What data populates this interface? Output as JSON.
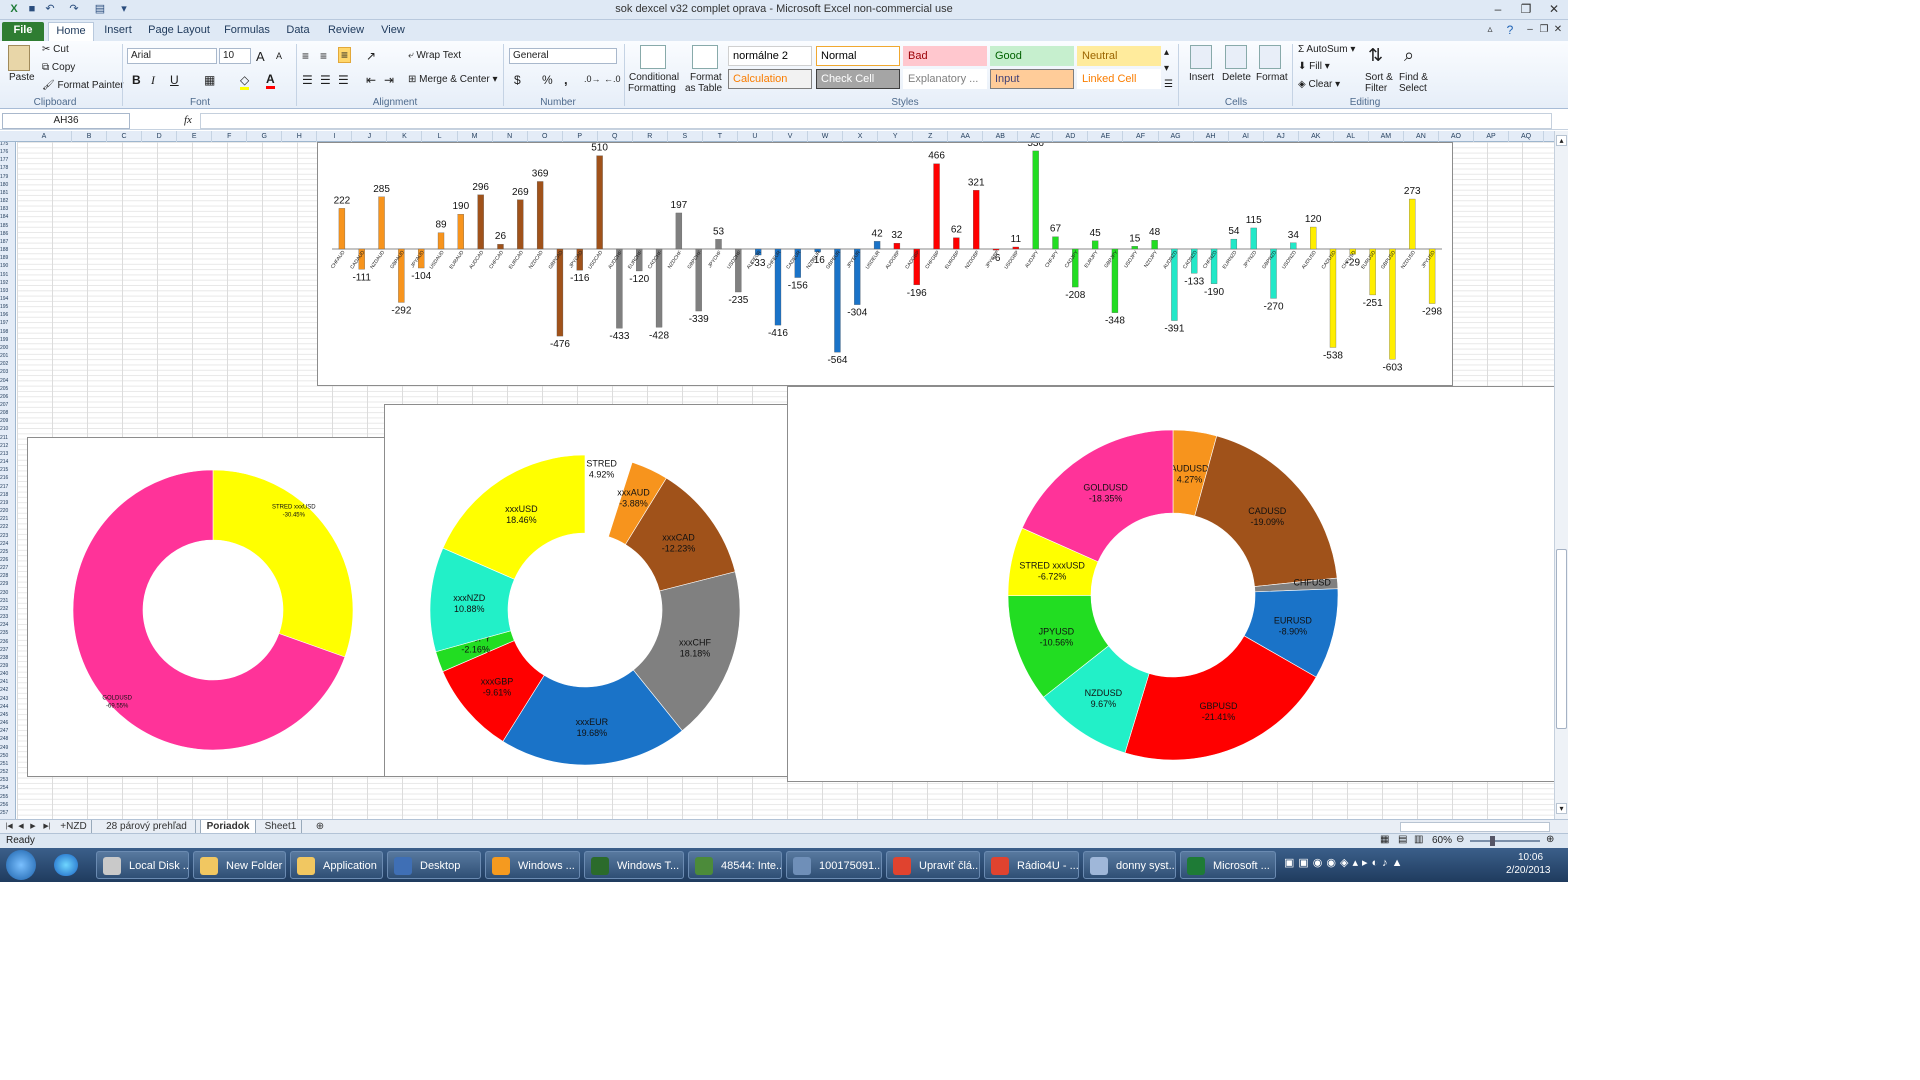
{
  "window": {
    "title": "sok dexcel v32 complet oprava  -  Microsoft Excel non-commercial use"
  },
  "qat": {
    "undo": "↶",
    "redo": "↷",
    "more": "▾"
  },
  "tabs": [
    "File",
    "Home",
    "Insert",
    "Page Layout",
    "Formulas",
    "Data",
    "Review",
    "View"
  ],
  "ribbon": {
    "clipboard": {
      "label": "Clipboard",
      "paste": "Paste",
      "cut": "Cut",
      "copy": "Copy",
      "format_painter": "Format Painter"
    },
    "font": {
      "label": "Font",
      "name": "Arial",
      "size": "10",
      "bold": "B",
      "italic": "I",
      "underline": "U",
      "grow": "A",
      "shrink": "A"
    },
    "alignment": {
      "label": "Alignment",
      "wrap": "Wrap Text",
      "merge": "Merge & Center"
    },
    "number": {
      "label": "Number",
      "format": "General",
      "currency": "$",
      "percent": "%",
      "comma": ","
    },
    "styles": {
      "label": "Styles",
      "cond": "Conditional",
      "cond2": "Formatting",
      "fmt_table": "Format",
      "fmt_table2": "as Table",
      "items": [
        {
          "name": "normálne 2",
          "bg": "#ffffff",
          "color": "#000000",
          "border": "#d0d0d0"
        },
        {
          "name": "Normal",
          "bg": "#ffffff",
          "color": "#000000",
          "border": "#f0a830"
        },
        {
          "name": "Bad",
          "bg": "#ffc7ce",
          "color": "#9c0006",
          "border": "#ffc7ce"
        },
        {
          "name": "Good",
          "bg": "#c6efce",
          "color": "#006100",
          "border": "#c6efce"
        },
        {
          "name": "Neutral",
          "bg": "#ffeb9c",
          "color": "#9c6500",
          "border": "#ffeb9c"
        },
        {
          "name": "Calculation",
          "bg": "#f2f2f2",
          "color": "#fa7d00",
          "border": "#7f7f7f"
        },
        {
          "name": "Check Cell",
          "bg": "#a5a5a5",
          "color": "#ffffff",
          "border": "#3f3f3f"
        },
        {
          "name": "Explanatory ...",
          "bg": "#ffffff",
          "color": "#7f7f7f",
          "border": "#ffffff"
        },
        {
          "name": "Input",
          "bg": "#ffcc99",
          "color": "#3f3f76",
          "border": "#7f7f7f"
        },
        {
          "name": "Linked Cell",
          "bg": "#ffffff",
          "color": "#fa7d00",
          "border": "#ffffff"
        }
      ]
    },
    "cells": {
      "label": "Cells",
      "insert": "Insert",
      "delete": "Delete",
      "format": "Format"
    },
    "editing": {
      "label": "Editing",
      "autosum": "AutoSum",
      "fill": "Fill",
      "clear": "Clear",
      "sort": "Sort &",
      "sort2": "Filter",
      "find": "Find &",
      "find2": "Select"
    }
  },
  "formula": {
    "namebox": "AH36",
    "fx": "fx",
    "value": ""
  },
  "columns": [
    "A",
    "B",
    "C",
    "D",
    "E",
    "F",
    "G",
    "H",
    "I",
    "J",
    "K",
    "L",
    "M",
    "N",
    "O",
    "P",
    "Q",
    "R",
    "S",
    "T",
    "U",
    "V",
    "W",
    "X",
    "Y",
    "Z",
    "AA",
    "AB",
    "AC",
    "AD",
    "AE",
    "AF",
    "AG",
    "AH",
    "AI",
    "AJ",
    "AK",
    "AL",
    "AM",
    "AN",
    "AO",
    "AP",
    "AQ",
    "AR",
    "AS",
    "AT"
  ],
  "rows_start": 175,
  "rows_end": 257,
  "sheets": {
    "nav": [
      "|◀",
      "◀",
      "▶",
      "▶|"
    ],
    "tabs": [
      "+NZD",
      "28 párový prehľad",
      "Poriadok",
      "Sheet1"
    ],
    "active": "Poriadok"
  },
  "status": {
    "ready": "Ready",
    "zoom": "60%"
  },
  "taskbar": {
    "items": [
      {
        "label": "Local Disk ...",
        "color": "#c9c9c9"
      },
      {
        "label": "New Folder",
        "color": "#f1c761"
      },
      {
        "label": "Application",
        "color": "#f1c761"
      },
      {
        "label": "Desktop",
        "color": "#3f6fb5"
      },
      {
        "label": "Windows ...",
        "color": "#f59a1f"
      },
      {
        "label": "Windows T...",
        "color": "#2b6b2b"
      },
      {
        "label": "48544: Inte...",
        "color": "#4c8b3a"
      },
      {
        "label": "100175091...",
        "color": "#6f8fb8"
      },
      {
        "label": "Upraviť člá...",
        "color": "#e0432f"
      },
      {
        "label": "Rádio4U - ...",
        "color": "#e0432f"
      },
      {
        "label": "donny syst...",
        "color": "#9fb7d9"
      },
      {
        "label": "Microsoft ...",
        "color": "#1e7b36"
      }
    ],
    "time": "10:06",
    "date": "2/20/2013"
  },
  "chart_data": [
    {
      "type": "bar",
      "categories": [
        "CHFAUD",
        "CADAUD",
        "NZDAUD",
        "GBPAUD",
        "JPYAUD",
        "USDAUD",
        "EURAUD",
        "AUDCAD",
        "CHFCAD",
        "EURCAD",
        "NZDCAD",
        "GBPCAD",
        "JPYCAD",
        "USDCAD",
        "AUDCHF",
        "EURCHF",
        "CADCHF",
        "NZDCHF",
        "GBPCHF",
        "JPYCHF",
        "USDCHF",
        "AUDEUR",
        "CHFEUR",
        "CADEUR",
        "NZDEUR",
        "GBPEUR",
        "JPYEUR",
        "USDEUR",
        "AUDGBP",
        "CADGBP",
        "CHFGBP",
        "EURGBP",
        "NZDGBP",
        "JPYGBP",
        "USDGBP",
        "AUDJPY",
        "CHFJPY",
        "CADJPY",
        "EURJPY",
        "GBPJPY",
        "USDJPY",
        "NZDJPY",
        "AUDNZD",
        "CADNZD",
        "CHFNZD",
        "EURNZD",
        "JPYNZD",
        "GBPNZD",
        "USDNZD",
        "AUDUSD",
        "CADUSD",
        "CHFUSD",
        "EURUSD",
        "GBPUSD",
        "NZDUSD",
        "JPYUSD"
      ],
      "values": [
        222,
        -111,
        285,
        -292,
        -104,
        89,
        190,
        296,
        26,
        269,
        369,
        -476,
        -116,
        510,
        -433,
        -120,
        -428,
        197,
        -339,
        53,
        -235,
        -33,
        -416,
        -156,
        -16,
        -564,
        -304,
        42,
        32,
        -196,
        466,
        62,
        321,
        -6,
        11,
        536,
        67,
        -208,
        45,
        -348,
        15,
        48,
        -391,
        -133,
        -190,
        54,
        115,
        -270,
        34,
        120,
        -538,
        -29,
        -251,
        -603,
        273,
        -298
      ],
      "colors": [
        "#f7941d",
        "#f7941d",
        "#f7941d",
        "#f7941d",
        "#f7941d",
        "#f7941d",
        "#f7941d",
        "#a0521a",
        "#a0521a",
        "#a0521a",
        "#a0521a",
        "#a0521a",
        "#a0521a",
        "#a0521a",
        "#808080",
        "#808080",
        "#808080",
        "#808080",
        "#808080",
        "#808080",
        "#808080",
        "#1a73c8",
        "#1a73c8",
        "#1a73c8",
        "#1a73c8",
        "#1a73c8",
        "#1a73c8",
        "#1a73c8",
        "#ff0000",
        "#ff0000",
        "#ff0000",
        "#ff0000",
        "#ff0000",
        "#ff0000",
        "#ff0000",
        "#22dd22",
        "#22dd22",
        "#22dd22",
        "#22dd22",
        "#22dd22",
        "#22dd22",
        "#22dd22",
        "#22e8c8",
        "#22e8c8",
        "#22e8c8",
        "#22e8c8",
        "#22e8c8",
        "#22e8c8",
        "#22e8c8",
        "#ffee00",
        "#ffee00",
        "#ffee00",
        "#ffee00",
        "#ffee00",
        "#ffee00",
        "#ffee00"
      ],
      "ylim": [
        -650,
        560
      ]
    },
    {
      "type": "pie",
      "donut": true,
      "slices": [
        {
          "label": "STRED xxxUSD",
          "pct": "-30.45%",
          "value": 30.45,
          "color": "#ffff00"
        },
        {
          "label": "GOLDUSD",
          "pct": "-69.55%",
          "value": 69.55,
          "color": "#ff3399"
        }
      ]
    },
    {
      "type": "pie",
      "donut": true,
      "slices": [
        {
          "label": "STRED",
          "pct": "4.92%",
          "value": 4.92,
          "color": "#ffffff",
          "exploded": true
        },
        {
          "label": "xxxAUD",
          "pct": "-3.88%",
          "value": 3.88,
          "color": "#f7941d"
        },
        {
          "label": "xxxCAD",
          "pct": "-12.23%",
          "value": 12.23,
          "color": "#a0521a"
        },
        {
          "label": "xxxCHF",
          "pct": "18.18%",
          "value": 18.18,
          "color": "#808080"
        },
        {
          "label": "xxxEUR",
          "pct": "19.68%",
          "value": 19.68,
          "color": "#1a73c8"
        },
        {
          "label": "xxxGBP",
          "pct": "-9.61%",
          "value": 9.61,
          "color": "#ff0000"
        },
        {
          "label": "xxxJPY",
          "pct": "-2.16%",
          "value": 2.16,
          "color": "#22dd22"
        },
        {
          "label": "xxxNZD",
          "pct": "10.88%",
          "value": 10.88,
          "color": "#22f0c8"
        },
        {
          "label": "xxxUSD",
          "pct": "18.46%",
          "value": 18.46,
          "color": "#ffff00"
        }
      ]
    },
    {
      "type": "pie",
      "donut": true,
      "slices": [
        {
          "label": "AUDUSD",
          "pct": "4.27%",
          "value": 4.27,
          "color": "#f7941d"
        },
        {
          "label": "CADUSD",
          "pct": "-19.09%",
          "value": 19.09,
          "color": "#a0521a"
        },
        {
          "label": "CHFUSD",
          "pct": "-1.03%",
          "value": 1.03,
          "color": "#808080"
        },
        {
          "label": "EURUSD",
          "pct": "-8.90%",
          "value": 8.9,
          "color": "#1a73c8"
        },
        {
          "label": "GBPUSD",
          "pct": "-21.41%",
          "value": 21.41,
          "color": "#ff0000"
        },
        {
          "label": "NZDUSD",
          "pct": "9.67%",
          "value": 9.67,
          "color": "#22f0c8"
        },
        {
          "label": "JPYUSD",
          "pct": "-10.56%",
          "value": 10.56,
          "color": "#22dd22"
        },
        {
          "label": "STRED xxxUSD",
          "pct": "-6.72%",
          "value": 6.72,
          "color": "#ffff00"
        },
        {
          "label": "GOLDUSD",
          "pct": "-18.35%",
          "value": 18.35,
          "color": "#ff3399"
        }
      ]
    }
  ]
}
